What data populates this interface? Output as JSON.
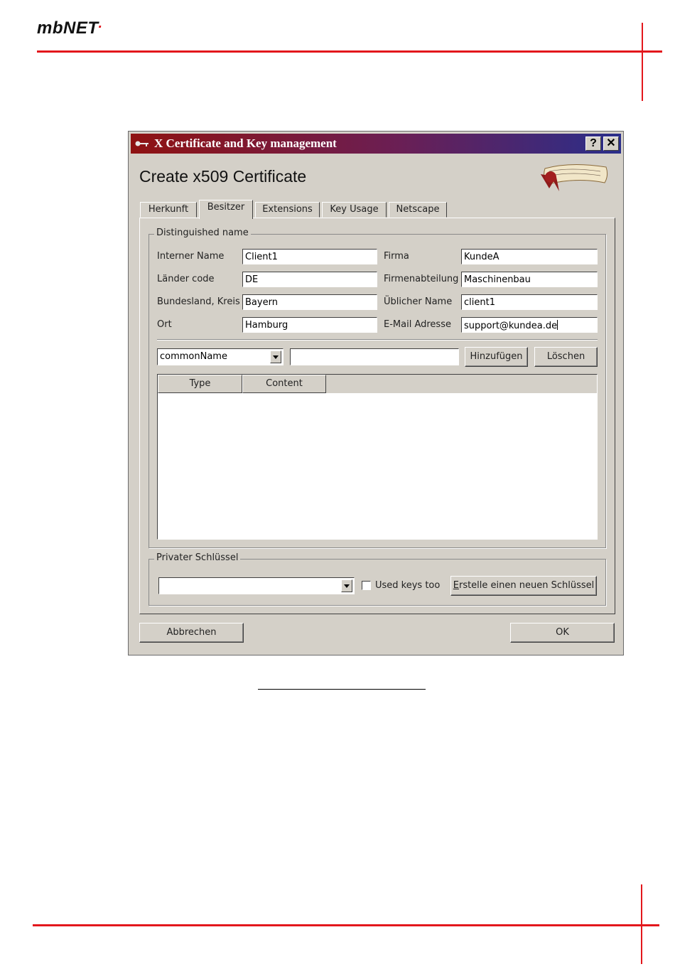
{
  "page": {
    "logo": "mbNET",
    "logo_mark": "."
  },
  "window": {
    "title": "X Certificate and Key management",
    "help_btn": "?",
    "close_btn": "✕",
    "heading": "Create x509 Certificate",
    "tabs": [
      "Herkunft",
      "Besitzer",
      "Extensions",
      "Key Usage",
      "Netscape"
    ],
    "active_tab": "Besitzer"
  },
  "dn": {
    "group_title": "Distinguished name",
    "fields": {
      "internal_name": {
        "label": "Interner Name",
        "value": "Client1"
      },
      "country": {
        "label": "Länder code",
        "value": "DE"
      },
      "state": {
        "label": "Bundesland, Kreis",
        "value": "Bayern"
      },
      "locality": {
        "label": "Ort",
        "value": "Hamburg"
      },
      "org": {
        "label": "Firma",
        "value": "KundeA"
      },
      "org_unit": {
        "label": "Firmenabteilung",
        "value": "Maschinenbau"
      },
      "common_name": {
        "label": "Üblicher Name",
        "value": "client1"
      },
      "email": {
        "label": "E-Mail Adresse",
        "value": "support@kundea.de"
      }
    },
    "type_select": "commonName",
    "value_input": "",
    "add_button": "Hinzufügen",
    "delete_button": "Löschen",
    "table_columns": [
      "Type",
      "Content"
    ]
  },
  "private_key": {
    "group_title": "Privater Schlüssel",
    "select_value": "",
    "used_keys_label": "Used keys too",
    "used_keys_checked": false,
    "new_key_button_prefix": "E",
    "new_key_button_rest": "rstelle einen neuen Schlüssel"
  },
  "footer": {
    "cancel": "Abbrechen",
    "ok": "OK"
  }
}
